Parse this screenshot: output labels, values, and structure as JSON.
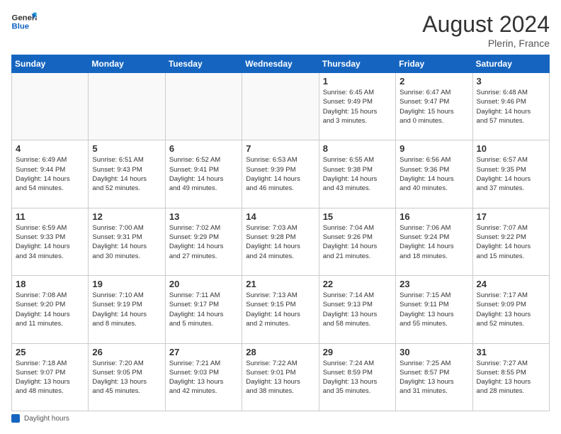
{
  "header": {
    "logo_line1": "General",
    "logo_line2": "Blue",
    "month_year": "August 2024",
    "location": "Plerin, France"
  },
  "days_of_week": [
    "Sunday",
    "Monday",
    "Tuesday",
    "Wednesday",
    "Thursday",
    "Friday",
    "Saturday"
  ],
  "weeks": [
    [
      {
        "day": "",
        "info": ""
      },
      {
        "day": "",
        "info": ""
      },
      {
        "day": "",
        "info": ""
      },
      {
        "day": "",
        "info": ""
      },
      {
        "day": "1",
        "info": "Sunrise: 6:45 AM\nSunset: 9:49 PM\nDaylight: 15 hours\nand 3 minutes."
      },
      {
        "day": "2",
        "info": "Sunrise: 6:47 AM\nSunset: 9:47 PM\nDaylight: 15 hours\nand 0 minutes."
      },
      {
        "day": "3",
        "info": "Sunrise: 6:48 AM\nSunset: 9:46 PM\nDaylight: 14 hours\nand 57 minutes."
      }
    ],
    [
      {
        "day": "4",
        "info": "Sunrise: 6:49 AM\nSunset: 9:44 PM\nDaylight: 14 hours\nand 54 minutes."
      },
      {
        "day": "5",
        "info": "Sunrise: 6:51 AM\nSunset: 9:43 PM\nDaylight: 14 hours\nand 52 minutes."
      },
      {
        "day": "6",
        "info": "Sunrise: 6:52 AM\nSunset: 9:41 PM\nDaylight: 14 hours\nand 49 minutes."
      },
      {
        "day": "7",
        "info": "Sunrise: 6:53 AM\nSunset: 9:39 PM\nDaylight: 14 hours\nand 46 minutes."
      },
      {
        "day": "8",
        "info": "Sunrise: 6:55 AM\nSunset: 9:38 PM\nDaylight: 14 hours\nand 43 minutes."
      },
      {
        "day": "9",
        "info": "Sunrise: 6:56 AM\nSunset: 9:36 PM\nDaylight: 14 hours\nand 40 minutes."
      },
      {
        "day": "10",
        "info": "Sunrise: 6:57 AM\nSunset: 9:35 PM\nDaylight: 14 hours\nand 37 minutes."
      }
    ],
    [
      {
        "day": "11",
        "info": "Sunrise: 6:59 AM\nSunset: 9:33 PM\nDaylight: 14 hours\nand 34 minutes."
      },
      {
        "day": "12",
        "info": "Sunrise: 7:00 AM\nSunset: 9:31 PM\nDaylight: 14 hours\nand 30 minutes."
      },
      {
        "day": "13",
        "info": "Sunrise: 7:02 AM\nSunset: 9:29 PM\nDaylight: 14 hours\nand 27 minutes."
      },
      {
        "day": "14",
        "info": "Sunrise: 7:03 AM\nSunset: 9:28 PM\nDaylight: 14 hours\nand 24 minutes."
      },
      {
        "day": "15",
        "info": "Sunrise: 7:04 AM\nSunset: 9:26 PM\nDaylight: 14 hours\nand 21 minutes."
      },
      {
        "day": "16",
        "info": "Sunrise: 7:06 AM\nSunset: 9:24 PM\nDaylight: 14 hours\nand 18 minutes."
      },
      {
        "day": "17",
        "info": "Sunrise: 7:07 AM\nSunset: 9:22 PM\nDaylight: 14 hours\nand 15 minutes."
      }
    ],
    [
      {
        "day": "18",
        "info": "Sunrise: 7:08 AM\nSunset: 9:20 PM\nDaylight: 14 hours\nand 11 minutes."
      },
      {
        "day": "19",
        "info": "Sunrise: 7:10 AM\nSunset: 9:19 PM\nDaylight: 14 hours\nand 8 minutes."
      },
      {
        "day": "20",
        "info": "Sunrise: 7:11 AM\nSunset: 9:17 PM\nDaylight: 14 hours\nand 5 minutes."
      },
      {
        "day": "21",
        "info": "Sunrise: 7:13 AM\nSunset: 9:15 PM\nDaylight: 14 hours\nand 2 minutes."
      },
      {
        "day": "22",
        "info": "Sunrise: 7:14 AM\nSunset: 9:13 PM\nDaylight: 13 hours\nand 58 minutes."
      },
      {
        "day": "23",
        "info": "Sunrise: 7:15 AM\nSunset: 9:11 PM\nDaylight: 13 hours\nand 55 minutes."
      },
      {
        "day": "24",
        "info": "Sunrise: 7:17 AM\nSunset: 9:09 PM\nDaylight: 13 hours\nand 52 minutes."
      }
    ],
    [
      {
        "day": "25",
        "info": "Sunrise: 7:18 AM\nSunset: 9:07 PM\nDaylight: 13 hours\nand 48 minutes."
      },
      {
        "day": "26",
        "info": "Sunrise: 7:20 AM\nSunset: 9:05 PM\nDaylight: 13 hours\nand 45 minutes."
      },
      {
        "day": "27",
        "info": "Sunrise: 7:21 AM\nSunset: 9:03 PM\nDaylight: 13 hours\nand 42 minutes."
      },
      {
        "day": "28",
        "info": "Sunrise: 7:22 AM\nSunset: 9:01 PM\nDaylight: 13 hours\nand 38 minutes."
      },
      {
        "day": "29",
        "info": "Sunrise: 7:24 AM\nSunset: 8:59 PM\nDaylight: 13 hours\nand 35 minutes."
      },
      {
        "day": "30",
        "info": "Sunrise: 7:25 AM\nSunset: 8:57 PM\nDaylight: 13 hours\nand 31 minutes."
      },
      {
        "day": "31",
        "info": "Sunrise: 7:27 AM\nSunset: 8:55 PM\nDaylight: 13 hours\nand 28 minutes."
      }
    ]
  ],
  "footer": {
    "note": "Daylight hours"
  }
}
